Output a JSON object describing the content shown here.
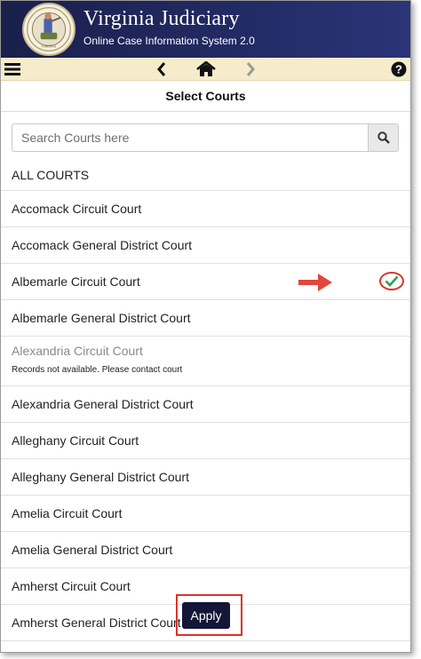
{
  "header": {
    "title": "Virginia Judiciary",
    "subtitle": "Online Case Information System 2.0",
    "colors": {
      "bar": "#222a63",
      "nav": "#f6eccb"
    }
  },
  "nav": {
    "menu_icon": "hamburger-menu-icon",
    "back_icon": "chevron-left-icon",
    "home_icon": "home-icon",
    "forward_icon": "chevron-right-icon",
    "help_icon": "question-circle-icon"
  },
  "page": {
    "heading": "Select Courts"
  },
  "search": {
    "placeholder": "Search Courts here",
    "value": "",
    "icon": "search-icon"
  },
  "courts": {
    "all_label": "ALL COURTS",
    "items": [
      {
        "label": "Accomack Circuit Court"
      },
      {
        "label": "Accomack General District Court"
      },
      {
        "label": "Albemarle Circuit Court",
        "selected": true
      },
      {
        "label": "Albemarle General District Court"
      },
      {
        "label": "Alexandria Circuit Court",
        "unavailable": true,
        "note": "Records not available. Please contact court"
      },
      {
        "label": "Alexandria General District Court"
      },
      {
        "label": "Alleghany Circuit Court"
      },
      {
        "label": "Alleghany General District Court"
      },
      {
        "label": "Amelia Circuit Court"
      },
      {
        "label": "Amelia General District Court"
      },
      {
        "label": "Amherst Circuit Court"
      },
      {
        "label": "Amherst General District Court"
      }
    ]
  },
  "apply": {
    "label": "Apply"
  },
  "annotation_colors": {
    "highlight": "#d9342b",
    "check": "#2e9e4f"
  }
}
